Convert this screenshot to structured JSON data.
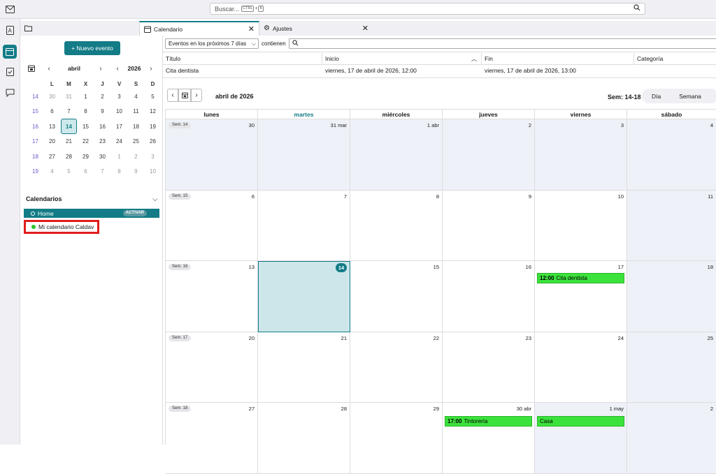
{
  "search": {
    "placeholder": "Buscar...",
    "key1": "CTRL",
    "plus": "+",
    "key2": "K"
  },
  "tabs": [
    {
      "label": "Calendario"
    },
    {
      "label": "Ajustes"
    }
  ],
  "sidebar": {
    "new_event": "+ Nuevo evento",
    "mini": {
      "month": "abril",
      "year": "2026",
      "headers": [
        "L",
        "M",
        "X",
        "J",
        "V",
        "S",
        "D"
      ],
      "weeks": [
        {
          "wk": "14",
          "days": [
            "30",
            "31",
            "1",
            "2",
            "3",
            "4",
            "5"
          ]
        },
        {
          "wk": "15",
          "days": [
            "6",
            "7",
            "8",
            "9",
            "10",
            "11",
            "12"
          ]
        },
        {
          "wk": "16",
          "days": [
            "13",
            "14",
            "15",
            "16",
            "17",
            "18",
            "19"
          ]
        },
        {
          "wk": "17",
          "days": [
            "20",
            "21",
            "22",
            "23",
            "24",
            "25",
            "26"
          ]
        },
        {
          "wk": "18",
          "days": [
            "27",
            "28",
            "29",
            "30",
            "1",
            "2",
            "3"
          ]
        },
        {
          "wk": "19",
          "days": [
            "4",
            "5",
            "6",
            "7",
            "8",
            "9",
            "10"
          ]
        }
      ]
    },
    "calendars_title": "Calendarios",
    "calendars": [
      {
        "name": "Home",
        "badge": "ACTIVAR"
      },
      {
        "name": "Mi calendario Caldav"
      }
    ]
  },
  "filter": {
    "select": "Eventos en los próximos 7 días",
    "label": "contienen",
    "input": ""
  },
  "list": {
    "headers": [
      "Título",
      "Inicio",
      "Fin",
      "Categoría"
    ],
    "rows": [
      {
        "title": "Cita dentista",
        "start": "viernes, 17 de abril de 2026, 12:00",
        "end": "viernes, 17 de abril de 2026, 13:00",
        "category": ""
      }
    ]
  },
  "toolbar": {
    "month": "abril de 2026",
    "weeks": "Sem: 14-18",
    "view_day": "Día",
    "view_week": "Semana"
  },
  "grid": {
    "days": [
      "lunes",
      "martes",
      "miércoles",
      "jueves",
      "viernes",
      "sábado"
    ],
    "weeks": [
      {
        "badge": "Sem. 14",
        "dates": [
          "30",
          "31 mar",
          "1 abr",
          "2",
          "3",
          "4"
        ]
      },
      {
        "badge": "Sem. 15",
        "dates": [
          "6",
          "7",
          "8",
          "9",
          "10",
          "11"
        ]
      },
      {
        "badge": "Sem. 16",
        "dates": [
          "13",
          "14",
          "15",
          "16",
          "17",
          "18"
        ]
      },
      {
        "badge": "Sem. 17",
        "dates": [
          "20",
          "21",
          "22",
          "23",
          "24",
          "25"
        ]
      },
      {
        "badge": "Sem. 18",
        "dates": [
          "27",
          "28",
          "29",
          "30 abr",
          "1 may",
          "2"
        ]
      }
    ],
    "events": [
      {
        "time": "12:00",
        "title": "Cita dentista"
      },
      {
        "time": "17:00",
        "title": "Tintorería"
      },
      {
        "time": "",
        "title": "Casa"
      }
    ]
  }
}
